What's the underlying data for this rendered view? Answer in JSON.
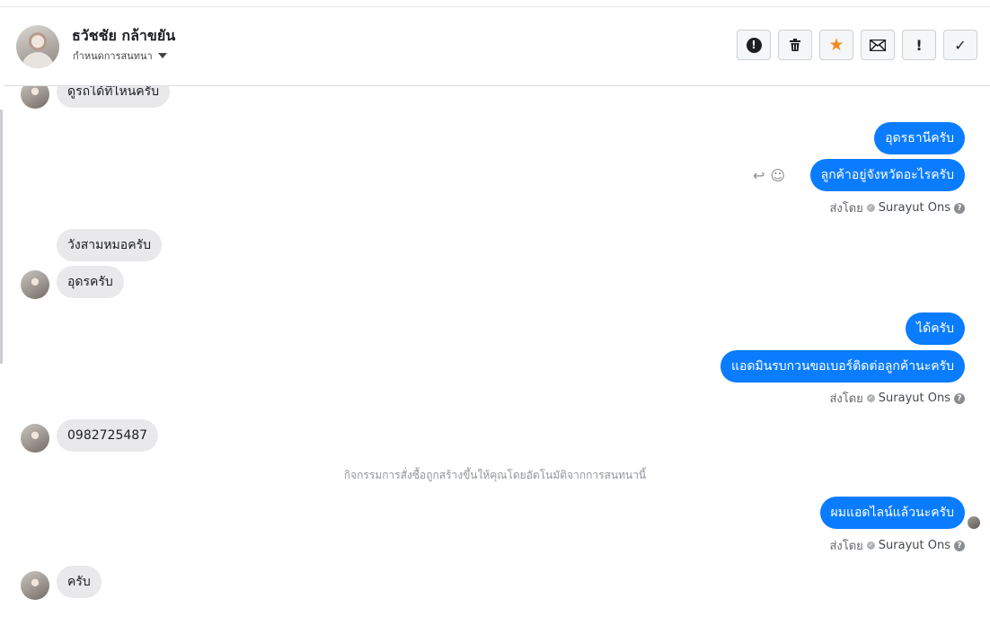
{
  "header": {
    "name": "ธวัชชัย กล้าขยัน",
    "subtitle": "กำหนดการสนทนา",
    "actions": [
      {
        "icon": "report-icon",
        "glyph": "!"
      },
      {
        "icon": "trash-icon",
        "glyph": "🗑"
      },
      {
        "icon": "star-icon",
        "glyph": "★"
      },
      {
        "icon": "mail-icon",
        "glyph": "✉"
      },
      {
        "icon": "important-icon",
        "glyph": "!"
      },
      {
        "icon": "check-icon",
        "glyph": "✓"
      }
    ]
  },
  "messages": {
    "m1": "ดูรถได้ที่ไหนครับ",
    "m2": "อุดรธานีครับ",
    "m3": "ลูกค้าอยู่จังหวัดอะไรครับ",
    "m4": "วังสามหมอครับ",
    "m5": "อุดรครับ",
    "m6": "ได้ครับ",
    "m7": "แอดมินรบกวนขอเบอร์ติดต่อลูกค้านะครับ",
    "m8": "0982725487",
    "m9": "ผมแอดไลน์แล้วนะครับ",
    "m10": "ครับ"
  },
  "sent_by": {
    "label": "ส่งโดย",
    "agent": "Surayut Ons"
  },
  "system_note": "กิจกรรมการสั่งซื้อถูกสร้างขึ้นให้คุณโดยอัตโนมัติจากการสนทนานี้",
  "colors": {
    "outgoing": "#0a7cff",
    "incoming": "#e9e9eb",
    "star": "#f38b1f"
  }
}
